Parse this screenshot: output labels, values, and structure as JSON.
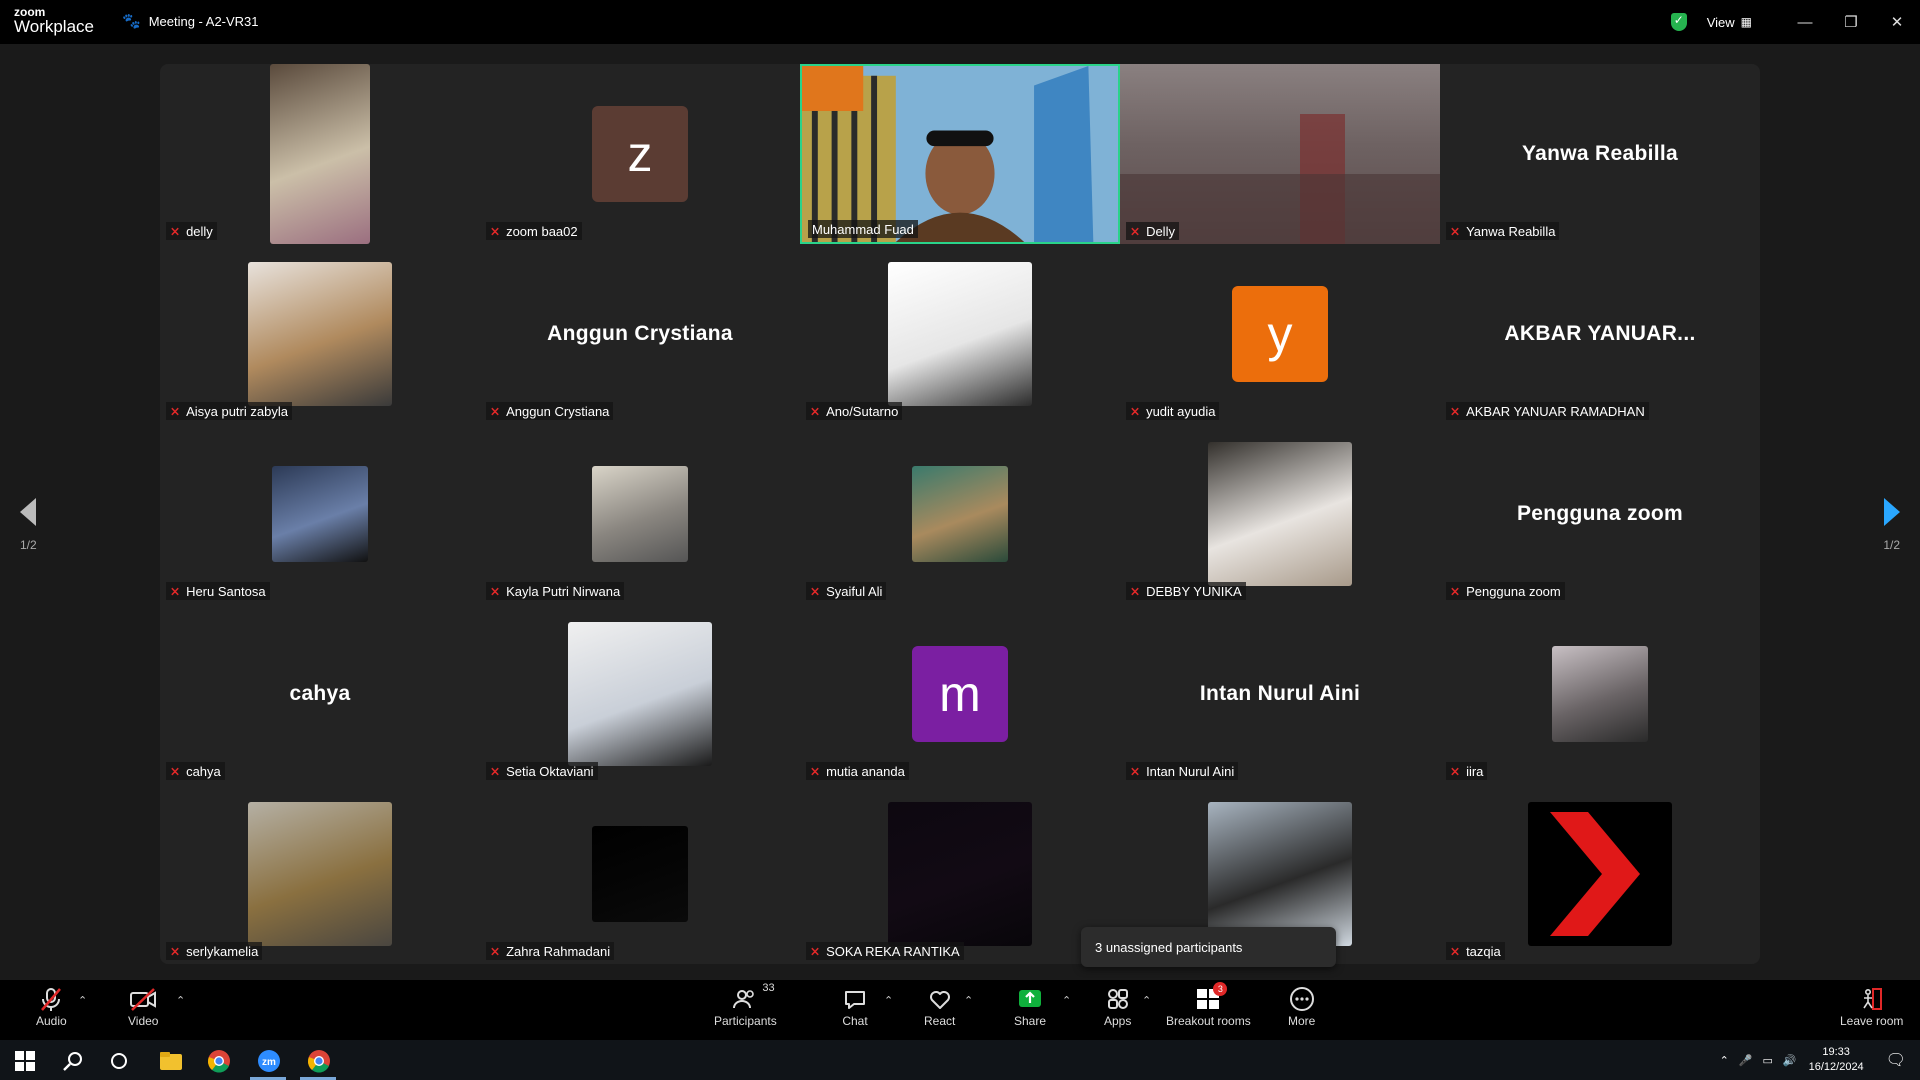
{
  "titlebar": {
    "logo_small": "zoom",
    "logo_big": "Workplace",
    "meeting_title": "Meeting - A2-VR31",
    "view_label": "View"
  },
  "pagination": {
    "left_label": "1/2",
    "right_label": "1/2"
  },
  "tiles": [
    {
      "name": "delly",
      "kind": "photo",
      "shape": "tall",
      "colors": [
        "#5a4a3c",
        "#cbbfa8",
        "#9b6f80"
      ]
    },
    {
      "name": "zoom baa02",
      "kind": "letter",
      "letter": "z",
      "bg": "#5b3c33"
    },
    {
      "name": "Muhammad Fuad",
      "kind": "video",
      "active": true
    },
    {
      "name": "Delly",
      "kind": "videodim"
    },
    {
      "name": "Yanwa Reabilla",
      "kind": "text",
      "display": "Yanwa Reabilla"
    },
    {
      "name": "Aisya putri zabyla",
      "kind": "photo",
      "shape": "sq",
      "colors": [
        "#e8e2dc",
        "#b08a5e",
        "#3a3a3a"
      ]
    },
    {
      "name": "Anggun Crystiana",
      "kind": "text",
      "display": "Anggun Crystiana"
    },
    {
      "name": "Ano/Sutarno",
      "kind": "photo",
      "shape": "sq",
      "colors": [
        "#ffffff",
        "#e6e6e6",
        "#2b2b2b"
      ]
    },
    {
      "name": "yudit ayudia",
      "kind": "letter",
      "letter": "y",
      "bg": "#ec6e0c"
    },
    {
      "name": "AKBAR YANUAR RAMADHAN",
      "kind": "text",
      "display": "AKBAR  YANUAR..."
    },
    {
      "name": "Heru Santosa",
      "kind": "photo",
      "shape": "md",
      "colors": [
        "#2c3a56",
        "#6a7fa8",
        "#111"
      ]
    },
    {
      "name": "Kayla Putri Nirwana",
      "kind": "photo",
      "shape": "md",
      "colors": [
        "#d9d4c8",
        "#8a8680",
        "#555"
      ]
    },
    {
      "name": "Syaiful Ali",
      "kind": "photo",
      "shape": "md",
      "colors": [
        "#3a7a6c",
        "#a98a5e",
        "#2a4a3a"
      ]
    },
    {
      "name": "DEBBY YUNIKA",
      "kind": "photo",
      "shape": "sq",
      "colors": [
        "#33302c",
        "#e8e4e0",
        "#a89a8a"
      ]
    },
    {
      "name": "Pengguna zoom",
      "kind": "text",
      "display": "Pengguna zoom"
    },
    {
      "name": "cahya",
      "kind": "text",
      "display": "cahya"
    },
    {
      "name": "Setia Oktaviani",
      "kind": "photo",
      "shape": "sq",
      "colors": [
        "#f0f0f0",
        "#c9cfd8",
        "#1a1a1a"
      ]
    },
    {
      "name": "mutia ananda",
      "kind": "letter",
      "letter": "m",
      "bg": "#7b1fa2"
    },
    {
      "name": "Intan Nurul Aini",
      "kind": "text",
      "display": "Intan Nurul Aini"
    },
    {
      "name": "iira",
      "kind": "photo",
      "shape": "md",
      "colors": [
        "#c8c0c4",
        "#6a6466",
        "#2a2a2a"
      ]
    },
    {
      "name": "serlykamelia",
      "kind": "photo",
      "shape": "sq",
      "colors": [
        "#b5b0a4",
        "#8a7040",
        "#4a4640"
      ]
    },
    {
      "name": "Zahra Rahmadani",
      "kind": "photo",
      "shape": "md",
      "colors": [
        "#000000",
        "#050505",
        "#0a0a0a"
      ]
    },
    {
      "name": "SOKA REKA RANTIKA",
      "kind": "photo",
      "shape": "sq",
      "colors": [
        "#0d0810",
        "#120a14",
        "#08060a"
      ]
    },
    {
      "name": "",
      "kind": "photo",
      "shape": "sq",
      "colors": [
        "#a8b4c0",
        "#2a2a2a",
        "#d0d8e0"
      ]
    },
    {
      "name": "tazqia",
      "kind": "chevron"
    }
  ],
  "popup": {
    "text": "3 unassigned participants"
  },
  "toolbar": {
    "audio": "Audio",
    "video": "Video",
    "participants": "Participants",
    "participants_count": "33",
    "chat": "Chat",
    "react": "React",
    "share": "Share",
    "apps": "Apps",
    "breakout": "Breakout rooms",
    "breakout_badge": "3",
    "more": "More",
    "leave": "Leave room"
  },
  "taskbar": {
    "time": "19:33",
    "date": "16/12/2024"
  },
  "colors": {
    "active_border": "#2ad38a",
    "share_green": "#0fb03c",
    "muted_red": "#e02828",
    "nav_blue": "#2aa7ff"
  }
}
